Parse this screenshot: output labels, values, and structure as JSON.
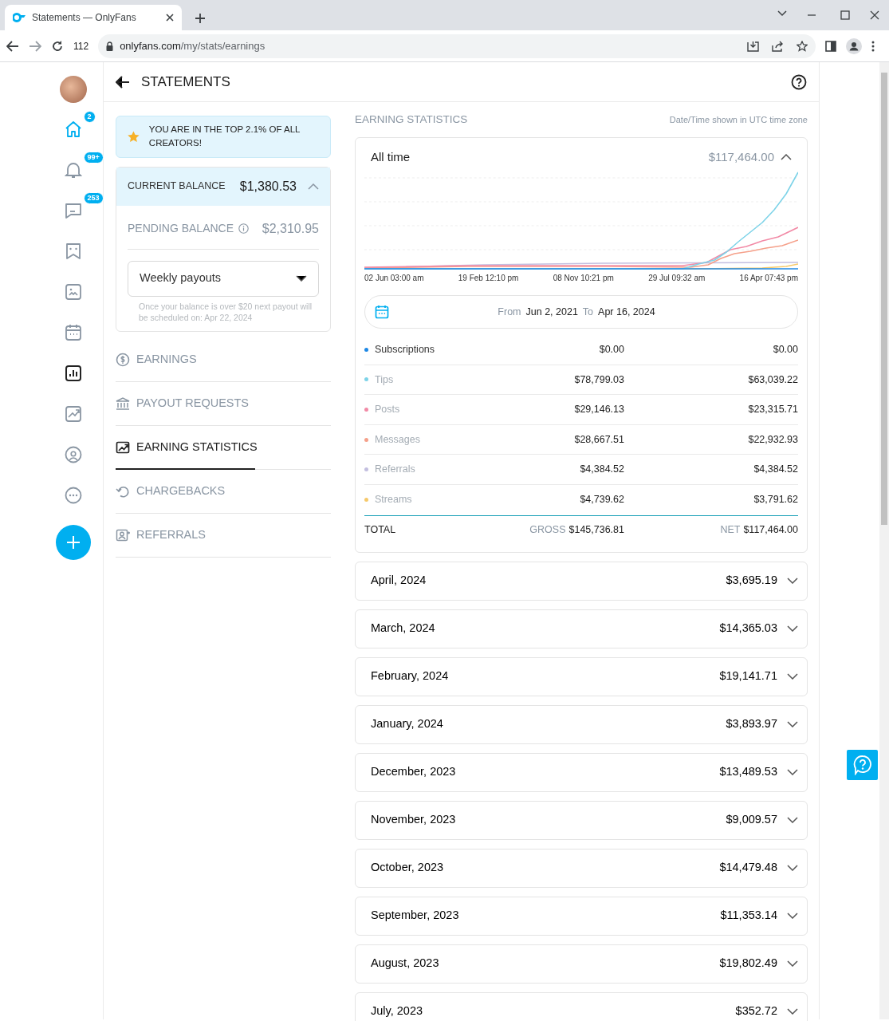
{
  "browser": {
    "tab_title": "Statements — OnlyFans",
    "url_host": "onlyfans.com",
    "url_path": "/my/stats/earnings",
    "extension_count": "112"
  },
  "rail": [
    {
      "kind": "avatar",
      "selected": false
    },
    {
      "kind": "home",
      "badge": "2",
      "selected": false
    },
    {
      "kind": "bell",
      "badge": "99+",
      "selected": false
    },
    {
      "kind": "chat",
      "badge": "253",
      "selected": false
    },
    {
      "kind": "bookmark",
      "selected": false
    },
    {
      "kind": "vault",
      "selected": false
    },
    {
      "kind": "calendar",
      "selected": false
    },
    {
      "kind": "statistics",
      "selected": true
    },
    {
      "kind": "analytics",
      "selected": false
    },
    {
      "kind": "profile",
      "selected": false
    },
    {
      "kind": "more",
      "selected": false
    },
    {
      "kind": "add",
      "selected": false
    }
  ],
  "header": {
    "title": "STATEMENTS"
  },
  "banner": {
    "text": "YOU ARE IN THE TOP 2.1% OF ALL CREATORS!"
  },
  "balance": {
    "current_label": "CURRENT BALANCE",
    "current_value": "$1,380.53",
    "expanded": true,
    "pending_label": "PENDING BALANCE",
    "pending_value": "$2,310.95",
    "payout_select": "Weekly payouts",
    "note": "Once your balance is over $20 next payout will be scheduled on: Apr 22, 2024"
  },
  "menu": [
    {
      "label": "EARNINGS",
      "kind": "dollar",
      "selected": false
    },
    {
      "label": "PAYOUT REQUESTS",
      "kind": "bank",
      "selected": false
    },
    {
      "label": "EARNING STATISTICS",
      "kind": "chart",
      "selected": true
    },
    {
      "label": "CHARGEBACKS",
      "kind": "undo",
      "selected": false
    },
    {
      "label": "REFERRALS",
      "kind": "person",
      "selected": false
    }
  ],
  "stats": {
    "heading": "EARNING STATISTICS",
    "timezone_note": "Date/Time shown in UTC time zone",
    "period": "All time",
    "period_total": "$117,464.00",
    "expanded": true,
    "x_labels": [
      "02 Jun 03:00 am",
      "19 Feb 12:10 pm",
      "08 Nov 10:21 pm",
      "29 Jul 09:32 am",
      "16 Apr 07:43 pm"
    ],
    "range": {
      "from_label": "From",
      "from": "Jun 2, 2021",
      "to_label": "To",
      "to": "Apr 16, 2024"
    },
    "categories": [
      {
        "name": "Subscriptions",
        "color": "#1e88e5",
        "gross": "$0.00",
        "net": "$0.00",
        "selected": true
      },
      {
        "name": "Tips",
        "color": "#7dd3e8",
        "gross": "$78,799.03",
        "net": "$63,039.22",
        "selected": false
      },
      {
        "name": "Posts",
        "color": "#f28aa6",
        "gross": "$29,146.13",
        "net": "$23,315.71",
        "selected": false
      },
      {
        "name": "Messages",
        "color": "#f5a08a",
        "gross": "$28,667.51",
        "net": "$22,932.93",
        "selected": false
      },
      {
        "name": "Referrals",
        "color": "#c3bfe0",
        "gross": "$4,384.52",
        "net": "$4,384.52",
        "selected": false
      },
      {
        "name": "Streams",
        "color": "#f6c96b",
        "gross": "$4,739.62",
        "net": "$3,791.62",
        "selected": false
      }
    ],
    "total": {
      "label": "TOTAL",
      "gross_label": "GROSS",
      "gross": "$145,736.81",
      "net_label": "NET",
      "net": "$117,464.00"
    }
  },
  "months": [
    {
      "label": "April, 2024",
      "amount": "$3,695.19",
      "expanded": false
    },
    {
      "label": "March, 2024",
      "amount": "$14,365.03",
      "expanded": false
    },
    {
      "label": "February, 2024",
      "amount": "$19,141.71",
      "expanded": false
    },
    {
      "label": "January, 2024",
      "amount": "$3,893.97",
      "expanded": false
    },
    {
      "label": "December, 2023",
      "amount": "$13,489.53",
      "expanded": false
    },
    {
      "label": "November, 2023",
      "amount": "$9,009.57",
      "expanded": false
    },
    {
      "label": "October, 2023",
      "amount": "$14,479.48",
      "expanded": false
    },
    {
      "label": "September, 2023",
      "amount": "$11,353.14",
      "expanded": false
    },
    {
      "label": "August, 2023",
      "amount": "$19,802.49",
      "expanded": false
    },
    {
      "label": "July, 2023",
      "amount": "$352.72",
      "expanded": false
    }
  ]
}
